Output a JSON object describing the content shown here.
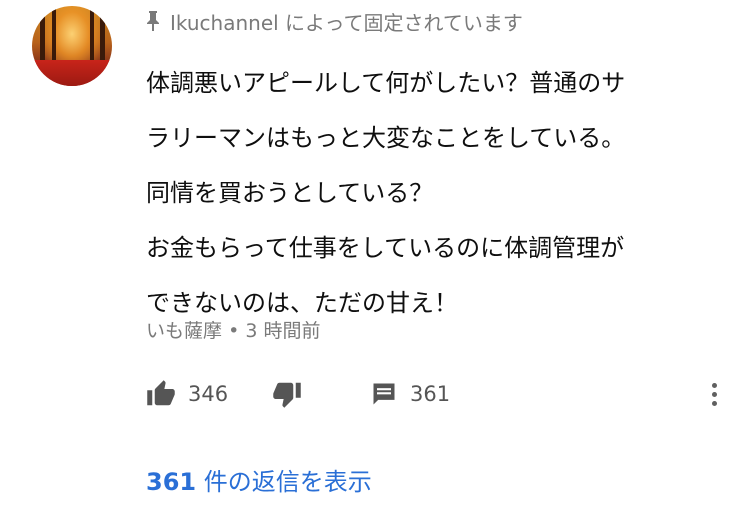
{
  "pinned": {
    "icon": "pin-icon",
    "channel": "Ikuchannel",
    "text": "によって固定されています"
  },
  "comment": {
    "lines": [
      "体調悪いアピールして何がしたい？普通のサ",
      "ラリーマンはもっと大変なことをしている。",
      "同情を買おうとしている？",
      "お金もらって仕事をしているのに体調管理が",
      "できないのは、ただの甘え！"
    ],
    "author": "いも薩摩",
    "separator": "•",
    "time": "3 時間前"
  },
  "actions": {
    "like_count": "346",
    "reply_count": "361"
  },
  "replies": {
    "count": "361",
    "label": "件の返信を表示"
  },
  "colors": {
    "link": "#2a6fd6",
    "muted": "#7a7a7a",
    "icon": "#555555"
  }
}
